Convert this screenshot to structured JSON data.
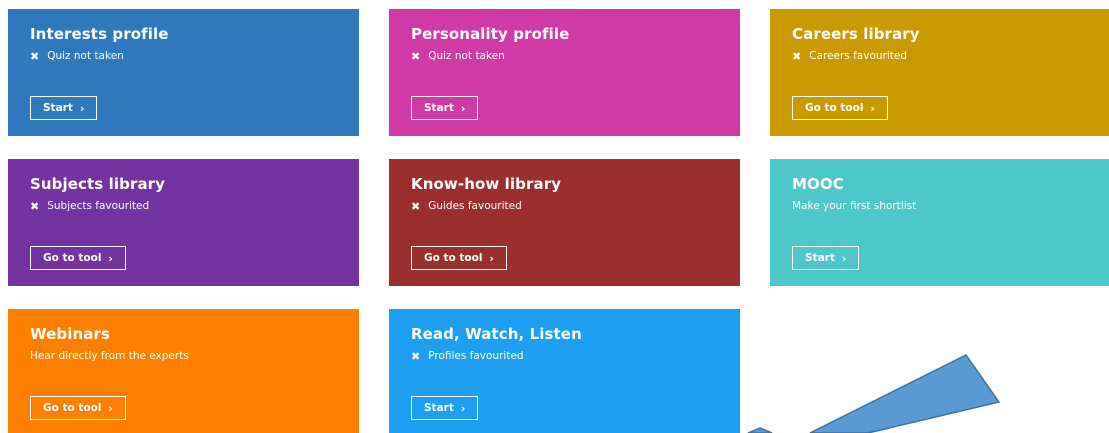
{
  "tiles": [
    {
      "title": "Interests profile",
      "status_icon": "x-icon",
      "status": "Quiz not taken",
      "button": "Start",
      "color": "#2e78bb"
    },
    {
      "title": "Personality profile",
      "status_icon": "x-icon",
      "status": "Quiz not taken",
      "button": "Start",
      "color": "#cf3aa7"
    },
    {
      "title": "Careers library",
      "status_icon": "x-icon",
      "status": "Careers favourited",
      "button": "Go to tool",
      "color": "#c99a00"
    },
    {
      "title": "Subjects library",
      "status_icon": "x-icon",
      "status": "Subjects favourited",
      "button": "Go to tool",
      "color": "#7333a1"
    },
    {
      "title": "Know-how library",
      "status_icon": "x-icon",
      "status": "Guides favourited",
      "button": "Go to tool",
      "color": "#9b2f2f"
    },
    {
      "title": "MOOC",
      "status_icon": "",
      "status": "Make your first shortlist",
      "button": "Start",
      "color": "#4ec7c9"
    },
    {
      "title": "Webinars",
      "status_icon": "",
      "status": "Hear directly from the experts",
      "button": "Go to tool",
      "color": "#ff7f00"
    },
    {
      "title": "Read, Watch, Listen",
      "status_icon": "x-icon",
      "status": "Profiles favourited",
      "button": "Start",
      "color": "#1e9ff2"
    }
  ],
  "overlay": {
    "shape": "arrow-annotation",
    "fill": "#5b9bd5",
    "stroke": "#41719c"
  }
}
